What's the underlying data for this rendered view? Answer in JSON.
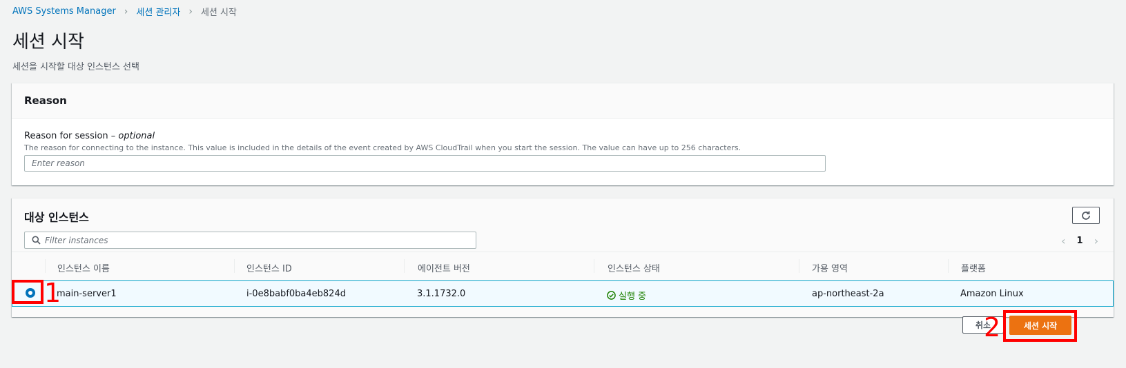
{
  "breadcrumb": {
    "items": [
      "AWS Systems Manager",
      "세션 관리자"
    ],
    "current": "세션 시작"
  },
  "page": {
    "title": "세션 시작",
    "description": "세션을 시작할 대상 인스턴스 선택"
  },
  "reason": {
    "header": "Reason",
    "label": "Reason for session – ",
    "label_optional": "optional",
    "description": "The reason for connecting to the instance. This value is included in the details of the event created by AWS CloudTrail when you start the session. The value can have up to 256 characters.",
    "placeholder": "Enter reason"
  },
  "targets": {
    "title": "대상 인스턴스",
    "filter_placeholder": "Filter instances",
    "page": "1",
    "columns": [
      "인스턴스 이름",
      "인스턴스 ID",
      "에이전트 버전",
      "인스턴스 상태",
      "가용 영역",
      "플랫폼"
    ],
    "rows": [
      {
        "name": "main-server1",
        "id": "i-0e8babf0ba4eb824d",
        "agent_version": "3.1.1732.0",
        "state": "실행 중",
        "az": "ap-northeast-2a",
        "platform": "Amazon Linux",
        "selected": true
      }
    ]
  },
  "actions": {
    "cancel_label": "취소",
    "start_label": "세션 시작"
  },
  "annotations": {
    "mark1": "1",
    "mark2": "2"
  },
  "colors": {
    "link": "#0073bb",
    "primary": "#ec7211",
    "success": "#1d8102",
    "annotation": "#ff0000"
  }
}
